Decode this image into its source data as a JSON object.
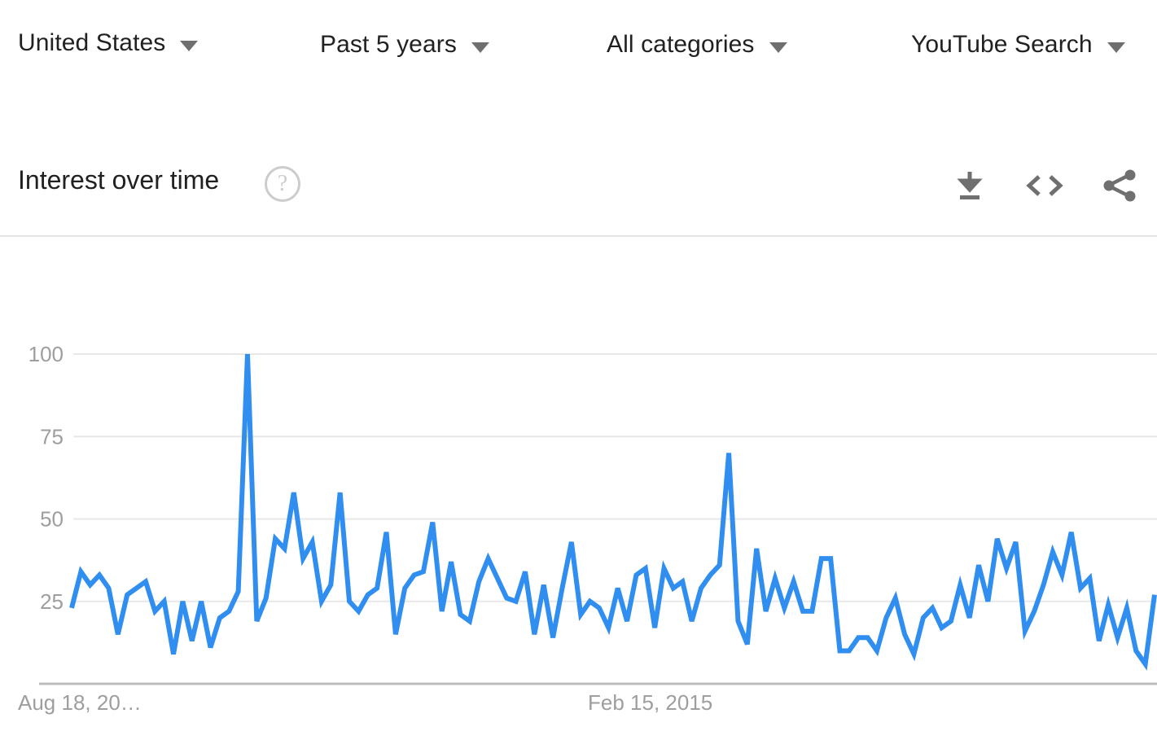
{
  "filters": [
    {
      "id": "country",
      "label": "United States",
      "caret_icon": "chevron-down-icon"
    },
    {
      "id": "time",
      "label": "Past 5 years",
      "caret_icon": "chevron-down-icon"
    },
    {
      "id": "category",
      "label": "All categories",
      "caret_icon": "chevron-down-icon"
    },
    {
      "id": "property",
      "label": "YouTube Search",
      "caret_icon": "chevron-down-icon"
    }
  ],
  "section": {
    "title": "Interest over time",
    "help_icon": "help-circle-icon",
    "help_glyph": "?",
    "actions": [
      {
        "id": "download",
        "icon": "download-icon",
        "label": "Download CSV"
      },
      {
        "id": "embed",
        "icon": "embed-code-icon",
        "label": "Embed"
      },
      {
        "id": "share",
        "icon": "share-icon",
        "label": "Share"
      }
    ]
  },
  "colors": {
    "line": "#2f8ef0",
    "grid": "#e8e8e8",
    "axis": "#bdbdbd",
    "tick_text": "#9e9e9e",
    "title_text": "#212121",
    "icon": "#6f6f6f"
  },
  "chart_data": {
    "type": "line",
    "title": "Interest over time",
    "xlabel": "",
    "ylabel": "",
    "ylim": [
      0,
      100
    ],
    "yticks": [
      25,
      50,
      75,
      100
    ],
    "ytick_labels": [
      "25",
      "50",
      "75",
      "100"
    ],
    "xticks": [
      0,
      129
    ],
    "xtick_labels": [
      "Aug 18, 20…",
      "Feb 15, 2015"
    ],
    "grid": true,
    "legend": false,
    "series": [
      {
        "name": "Interest",
        "color": "#2f8ef0",
        "values": [
          23,
          34,
          30,
          33,
          29,
          15,
          27,
          29,
          31,
          22,
          25,
          9,
          25,
          13,
          25,
          11,
          20,
          22,
          28,
          100,
          19,
          26,
          44,
          41,
          58,
          38,
          43,
          25,
          30,
          58,
          25,
          22,
          27,
          29,
          46,
          15,
          29,
          33,
          34,
          49,
          22,
          37,
          21,
          19,
          31,
          38,
          32,
          26,
          25,
          34,
          15,
          30,
          14,
          29,
          43,
          21,
          25,
          23,
          17,
          29,
          19,
          33,
          35,
          17,
          35,
          29,
          31,
          19,
          29,
          33,
          36,
          70,
          19,
          12,
          41,
          22,
          32,
          23,
          31,
          22,
          22,
          38,
          38,
          10,
          10,
          14,
          14,
          10,
          20,
          26,
          15,
          9,
          20,
          23,
          17,
          19,
          30,
          20,
          36,
          25,
          44,
          35,
          43,
          16,
          22,
          30,
          40,
          33,
          46,
          29,
          32,
          13,
          24,
          14,
          23,
          10,
          6,
          27
        ]
      }
    ]
  }
}
